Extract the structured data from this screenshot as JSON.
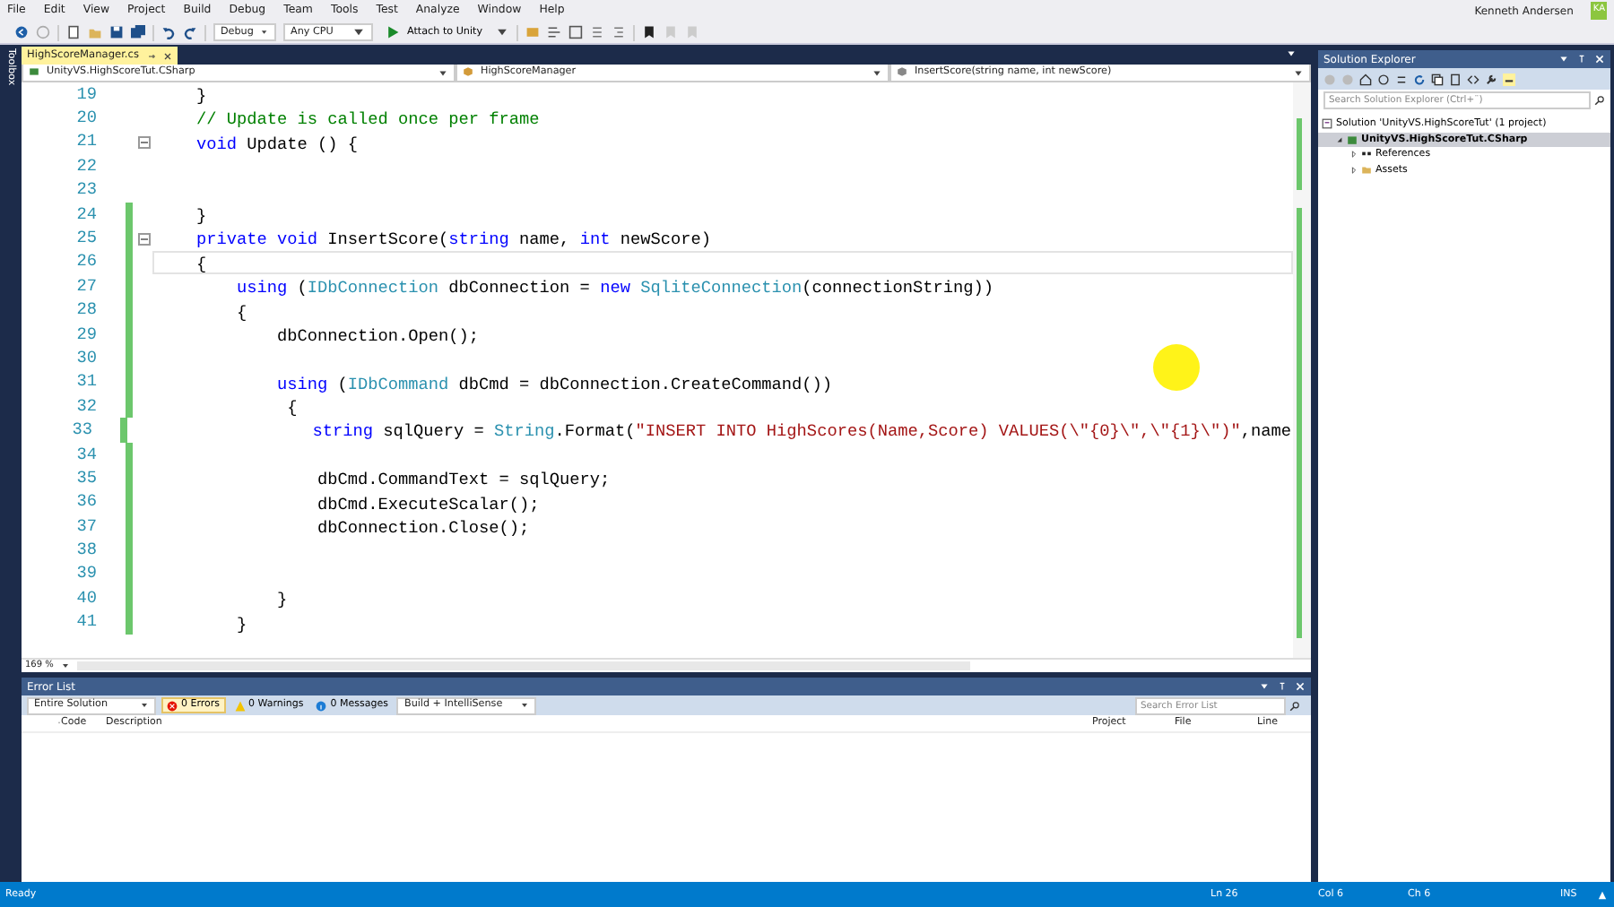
{
  "menu": [
    "File",
    "Edit",
    "View",
    "Project",
    "Build",
    "Debug",
    "Team",
    "Tools",
    "Test",
    "Analyze",
    "Window",
    "Help"
  ],
  "user": {
    "name": "Kenneth Andersen",
    "initials": "KA"
  },
  "toolbar": {
    "configuration": "Debug",
    "platform": "Any CPU",
    "run": "Attach to Unity"
  },
  "toolbox_tab": "Toolbox",
  "editor": {
    "tabs": [
      {
        "label": "HighScoreManager.cs",
        "selected": true
      }
    ],
    "nav": [
      "UnityVS.HighScoreTut.CSharp",
      "HighScoreManager",
      "InsertScore(string name, int newScore)"
    ],
    "zoom": "169 %",
    "lines": [
      {
        "number": "19",
        "changed": false,
        "foldable": false,
        "current": false,
        "tokens": [
          {
            "text": "    }",
            "kind": "plain"
          }
        ]
      },
      {
        "number": "20",
        "changed": false,
        "foldable": false,
        "current": false,
        "tokens": [
          {
            "text": "    // Update is called once per frame",
            "kind": "comment"
          }
        ]
      },
      {
        "number": "21",
        "changed": false,
        "foldable": true,
        "current": false,
        "tokens": [
          {
            "text": "    void",
            "kind": "keyword"
          },
          {
            "text": " Update () {",
            "kind": "plain"
          }
        ]
      },
      {
        "number": "22",
        "changed": false,
        "foldable": false,
        "current": false
      },
      {
        "number": "23",
        "changed": false,
        "foldable": false,
        "current": false
      },
      {
        "number": "24",
        "changed": true,
        "foldable": false,
        "current": false,
        "tokens": [
          {
            "text": "    }",
            "kind": "plain"
          }
        ]
      },
      {
        "number": "25",
        "changed": true,
        "foldable": true,
        "current": false,
        "tokens": [
          {
            "text": "    private void",
            "kind": "keyword"
          },
          {
            "text": " InsertScore(",
            "kind": "plain"
          },
          {
            "text": "string",
            "kind": "keyword"
          },
          {
            "text": " name, ",
            "kind": "plain"
          },
          {
            "text": "int",
            "kind": "keyword"
          },
          {
            "text": " newScore)",
            "kind": "plain"
          }
        ]
      },
      {
        "number": "26",
        "changed": true,
        "foldable": false,
        "current": true,
        "tokens": [
          {
            "text": "    {",
            "kind": "plain"
          }
        ]
      },
      {
        "number": "27",
        "changed": true,
        "foldable": false,
        "current": false,
        "tokens": [
          {
            "text": "        using",
            "kind": "keyword"
          },
          {
            "text": " (",
            "kind": "plain"
          },
          {
            "text": "IDbConnection",
            "kind": "type"
          },
          {
            "text": " dbConnection = ",
            "kind": "plain"
          },
          {
            "text": "new",
            "kind": "keyword"
          },
          {
            "text": " SqliteConnection",
            "kind": "type"
          },
          {
            "text": "(connectionString))",
            "kind": "plain"
          }
        ]
      },
      {
        "number": "28",
        "changed": true,
        "foldable": false,
        "current": false,
        "tokens": [
          {
            "text": "        {",
            "kind": "plain"
          }
        ]
      },
      {
        "number": "29",
        "changed": true,
        "foldable": false,
        "current": false,
        "tokens": [
          {
            "text": "            dbConnection.Open();",
            "kind": "plain"
          }
        ]
      },
      {
        "number": "30",
        "changed": true,
        "foldable": false,
        "current": false
      },
      {
        "number": "31",
        "changed": true,
        "foldable": false,
        "current": false,
        "tokens": [
          {
            "text": "            using",
            "kind": "keyword"
          },
          {
            "text": " (",
            "kind": "plain"
          },
          {
            "text": "IDbCommand",
            "kind": "type"
          },
          {
            "text": " dbCmd = dbConnection.CreateCommand())",
            "kind": "plain"
          }
        ]
      },
      {
        "number": "32",
        "changed": true,
        "foldable": false,
        "current": false,
        "tokens": [
          {
            "text": "             {",
            "kind": "plain"
          }
        ]
      },
      {
        "number": "33",
        "changed": true,
        "foldable": false,
        "current": false,
        "tokens": [
          {
            "text": "                string",
            "kind": "keyword"
          },
          {
            "text": " sqlQuery = ",
            "kind": "plain"
          },
          {
            "text": "String",
            "kind": "type"
          },
          {
            "text": ".Format(",
            "kind": "plain"
          },
          {
            "text": "\"INSERT INTO HighScores(Name,Score) VALUES(\\\"{0}\\\",\\\"{1}\\\")\"",
            "kind": "string"
          },
          {
            "text": ",name",
            "kind": "plain"
          }
        ]
      },
      {
        "number": "34",
        "changed": true,
        "foldable": false,
        "current": false
      },
      {
        "number": "35",
        "changed": true,
        "foldable": false,
        "current": false,
        "tokens": [
          {
            "text": "                dbCmd.CommandText = sqlQuery;",
            "kind": "plain"
          }
        ]
      },
      {
        "number": "36",
        "changed": true,
        "foldable": false,
        "current": false,
        "tokens": [
          {
            "text": "                dbCmd.ExecuteScalar();",
            "kind": "plain"
          }
        ]
      },
      {
        "number": "37",
        "changed": true,
        "foldable": false,
        "current": false,
        "tokens": [
          {
            "text": "                dbConnection.Close();",
            "kind": "plain"
          }
        ]
      },
      {
        "number": "38",
        "changed": true,
        "foldable": false,
        "current": false
      },
      {
        "number": "39",
        "changed": true,
        "foldable": false,
        "current": false
      },
      {
        "number": "40",
        "changed": true,
        "foldable": false,
        "current": false,
        "tokens": [
          {
            "text": "            }",
            "kind": "plain"
          }
        ]
      },
      {
        "number": "41",
        "changed": true,
        "foldable": false,
        "current": false,
        "tokens": [
          {
            "text": "        }",
            "kind": "plain"
          }
        ]
      }
    ]
  },
  "error_list": {
    "title": "Error List",
    "scope": "Entire Solution",
    "filters": [
      {
        "kind": "error",
        "label": "0 Errors",
        "selected": true
      },
      {
        "kind": "warning",
        "label": "0 Warnings",
        "selected": false
      },
      {
        "kind": "message",
        "label": "0 Messages",
        "selected": false
      }
    ],
    "source": "Build + IntelliSense",
    "search": {
      "placeholder": "Search Error List"
    },
    "columns": [
      "Code",
      "Description",
      "Project",
      "File",
      "Line"
    ]
  },
  "solution_explorer": {
    "title": "Solution Explorer",
    "search": {
      "placeholder": "Search Solution Explorer (Ctrl+¨)"
    },
    "tree": [
      {
        "label": "Solution 'UnityVS.HighScoreTut' (1 project)",
        "kind": "solution",
        "selected": false,
        "children": [
          {
            "label": "UnityVS.HighScoreTut.CSharp",
            "kind": "project",
            "selected": true,
            "expanded": true,
            "children": [
              {
                "label": "References",
                "kind": "references",
                "selected": false,
                "expanded": false
              },
              {
                "label": "Assets",
                "kind": "folder",
                "selected": false,
                "expanded": false
              }
            ]
          }
        ]
      }
    ]
  },
  "status_bar": {
    "message": "Ready",
    "line": "Ln 26",
    "column": "Col 6",
    "char": "Ch 6",
    "mode": "INS"
  }
}
